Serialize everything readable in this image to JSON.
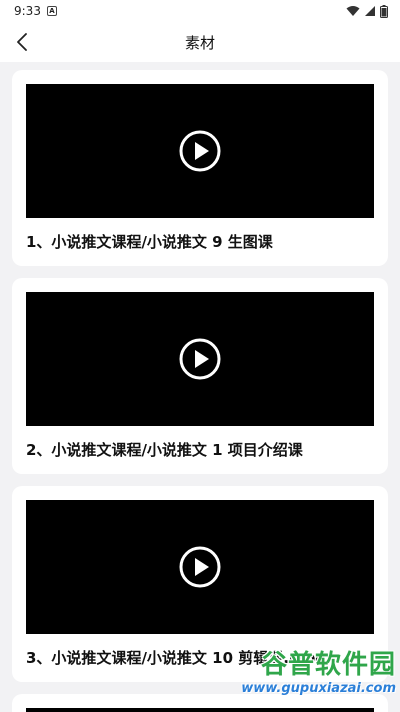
{
  "status_bar": {
    "time": "9:33",
    "notif_letter": "A"
  },
  "header": {
    "title": "素材"
  },
  "cards": [
    {
      "title": "1、小说推文课程/小说推文 9 生图课"
    },
    {
      "title": "2、小说推文课程/小说推文 1 项目介绍课"
    },
    {
      "title": "3、小说推文课程/小说推文 10 剪辑课.mp4"
    }
  ],
  "watermark": {
    "brand": "谷普软件园",
    "url": "www.gupuxiazai.com"
  },
  "colors": {
    "background": "#f2f2f4",
    "card": "#ffffff",
    "video": "#000000",
    "watermark_green": "#2fa64a",
    "watermark_blue": "#2b7fd8"
  }
}
